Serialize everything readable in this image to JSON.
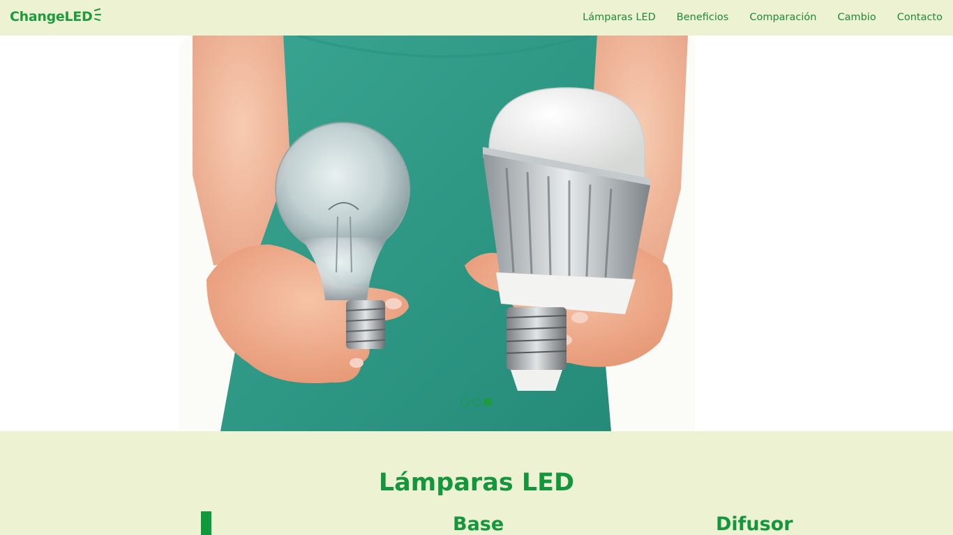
{
  "header": {
    "logo_text": "ChangeLED",
    "nav": [
      {
        "label": "Lámparas LED"
      },
      {
        "label": "Beneficios"
      },
      {
        "label": "Comparación"
      },
      {
        "label": "Cambio"
      },
      {
        "label": "Contacto"
      }
    ]
  },
  "hero": {
    "image_icon": "hands-holding-bulbs-photo",
    "slides_total": 3,
    "active_slide": 3
  },
  "section": {
    "title": "Lámparas LED",
    "columns": [
      {
        "title": "Base"
      },
      {
        "title": "Difusor"
      }
    ]
  },
  "colors": {
    "brand_green": "#1e9b3c",
    "background": "#edf2d2",
    "shirt_teal": "#2e9a86"
  }
}
